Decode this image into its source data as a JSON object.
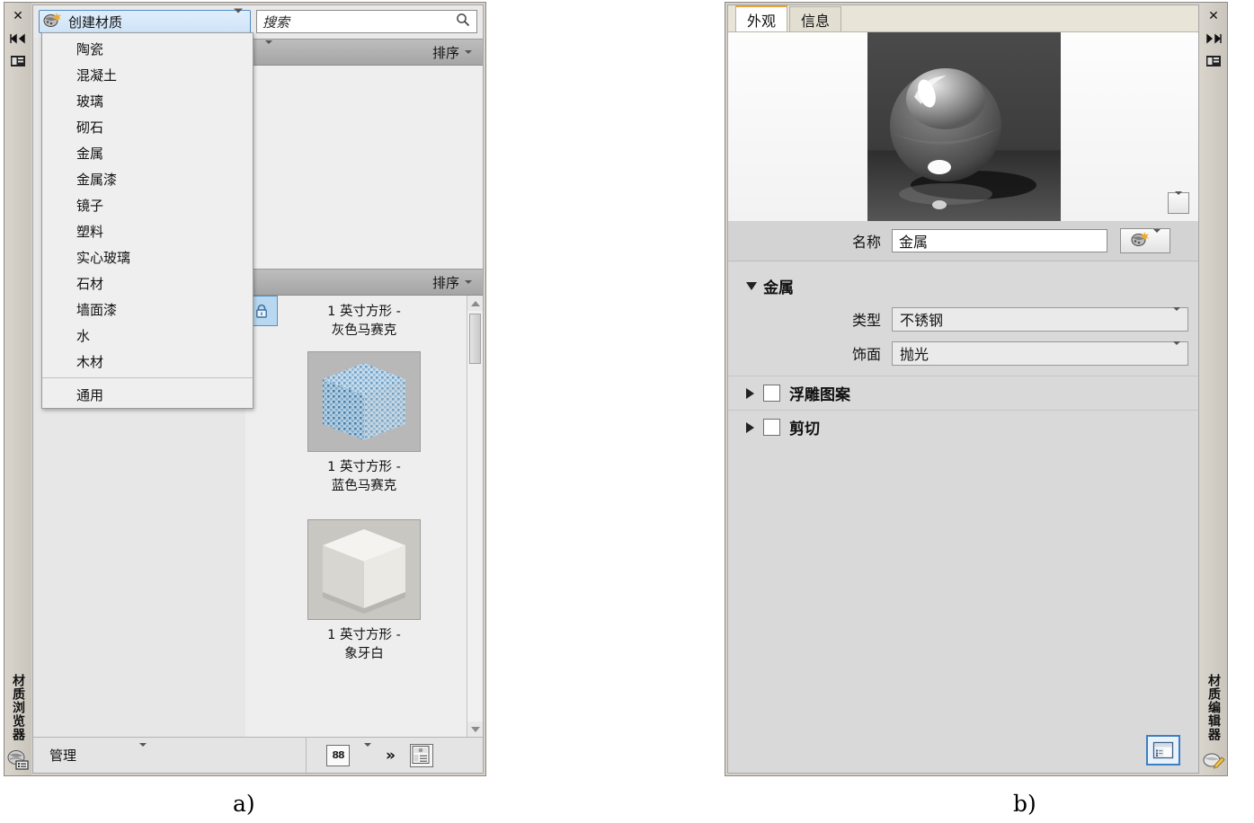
{
  "figure": {
    "caption_a": "a)",
    "caption_b": "b)"
  },
  "browser": {
    "rail": {
      "title": "材质浏览器",
      "close_icon": "close-icon",
      "dock_icon": "dock-arrows-icon",
      "panel_icon": "panel-icon",
      "bottom_icon": "material-browser-icon"
    },
    "create_button": {
      "label": "创建材质",
      "icon": "material-palette-icon"
    },
    "search": {
      "placeholder": "搜索",
      "value": "",
      "icon": "search-icon"
    },
    "dropdown": {
      "items": [
        "陶瓷",
        "混凝土",
        "玻璃",
        "砌石",
        "金属",
        "金属漆",
        "镜子",
        "塑料",
        "实心玻璃",
        "石材",
        "墙面漆",
        "水",
        "木材"
      ],
      "footer_item": "通用"
    },
    "sort_bar_top": {
      "label": "排序"
    },
    "sort_bar_mid": {
      "label": "排序"
    },
    "materials": [
      {
        "name_line1": "1 英寸方形 -",
        "name_line2": "灰色马赛克",
        "thumb": "gray-mosaic-cube"
      },
      {
        "name_line1": "1 英寸方形 -",
        "name_line2": "蓝色马赛克",
        "thumb": "blue-mosaic-cube"
      },
      {
        "name_line1": "1 英寸方形 -",
        "name_line2": "象牙白",
        "thumb": "ivory-white-cube"
      }
    ],
    "lock_icon": "lock-icon",
    "footer": {
      "manage_label": "管理",
      "grid_icon": "grid-view-icon",
      "more_icon": "double-chevron-icon",
      "panel_icon": "show-panel-icon"
    }
  },
  "editor": {
    "rail": {
      "title": "材质编辑器",
      "close_icon": "close-icon",
      "dock_icon": "dock-arrows-icon",
      "panel_icon": "panel-icon",
      "bottom_icon": "material-editor-icon"
    },
    "tabs": [
      {
        "label": "外观",
        "active": true
      },
      {
        "label": "信息",
        "active": false
      }
    ],
    "preview": {
      "image": "metal-sphere-preview",
      "dropdown_icon": "chevron-down-icon"
    },
    "name_field": {
      "label": "名称",
      "value": "金属",
      "button_icon": "material-palette-icon"
    },
    "section": {
      "title": "金属",
      "expanded": true,
      "properties": [
        {
          "label": "类型",
          "value": "不锈钢"
        },
        {
          "label": "饰面",
          "value": "抛光"
        }
      ]
    },
    "collapsed_sections": [
      {
        "label": "浮雕图案",
        "checked": false
      },
      {
        "label": "剪切",
        "checked": false
      }
    ],
    "footer": {
      "layout_button_icon": "panel-layout-icon",
      "layout_button_active": true
    }
  },
  "colors": {
    "accent_tab": "#e8a33d",
    "selection_blue": "#4f8cc9",
    "panel_bg": "#d6d2ca",
    "content_bg": "#e7e7e7"
  }
}
